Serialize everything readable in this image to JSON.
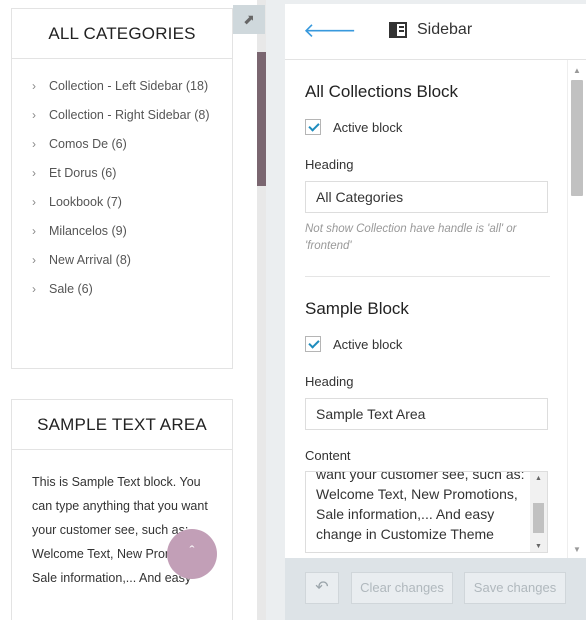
{
  "preview": {
    "categories_widget": {
      "title": "ALL CATEGORIES",
      "items": [
        {
          "label": "Collection - Left Sidebar (18)"
        },
        {
          "label": "Collection - Right Sidebar (8)"
        },
        {
          "label": "Comos De (6)"
        },
        {
          "label": "Et Dorus (6)"
        },
        {
          "label": "Lookbook (7)"
        },
        {
          "label": "Milancelos (9)"
        },
        {
          "label": "New Arrival (8)"
        },
        {
          "label": "Sale (6)"
        }
      ]
    },
    "sample_widget": {
      "title": "SAMPLE TEXT AREA",
      "body": "This is Sample Text block. You can type anything that you want your customer see, such as: Welcome Text, New Promotions, Sale information,... And easy"
    },
    "fab_icon": "chevron-up-icon",
    "expand_icon": "expand-arrow-icon"
  },
  "panel": {
    "back_icon": "back-arrow-icon",
    "title": "Sidebar",
    "title_icon": "sidebar-layout-icon",
    "blocks": [
      {
        "title": "All Collections Block",
        "active_label": "Active block",
        "active": true,
        "heading_label": "Heading",
        "heading_value": "All Categories",
        "hint": "Not show Collection have handle is 'all' or 'frontend'"
      },
      {
        "title": "Sample Block",
        "active_label": "Active block",
        "active": true,
        "heading_label": "Heading",
        "heading_value": "Sample Text Area",
        "content_label": "Content",
        "content_value": "want your customer see, such as: Welcome Text, New Promotions, Sale information,... And easy change in Customize Theme"
      }
    ]
  },
  "footer": {
    "undo_icon": "undo-icon",
    "clear_label": "Clear changes",
    "save_label": "Save changes"
  },
  "colors": {
    "accent": "#3899dd",
    "preview_scroll_thumb": "#7a6670",
    "fab": "#c29fb7"
  }
}
